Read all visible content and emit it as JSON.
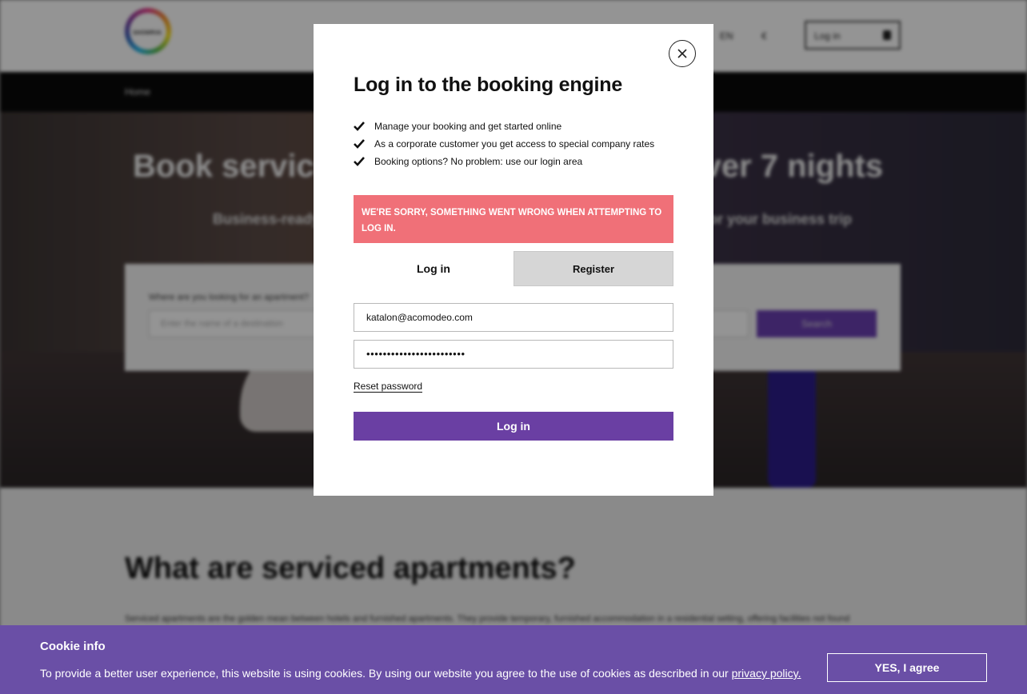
{
  "background": {
    "logo_text": "SHOWRVA",
    "language": "EN",
    "currency": "€",
    "header_login": "Log in",
    "breadcrumb": "Home",
    "hero_title": "Book serviced apartments for stays over 7 nights",
    "hero_subtitle": "Business-ready apartments",
    "hero_subtitle_2": "for your business trip",
    "search_label": "Where are you looking for an apartment?",
    "search_placeholder": "Enter the name of a destination",
    "search_button": "Search",
    "lower_title": "What are serviced apartments?",
    "lower_text": "Serviced apartments are the golden mean between hotels and furnished apartments. They provide temporary, furnished accommodation in a residential setting, offering facilities not found"
  },
  "modal": {
    "title": "Log in to the booking engine",
    "benefits": [
      "Manage your booking and get started online",
      "As a corporate customer you get access to special company rates",
      "Booking options? No problem: use our login area"
    ],
    "error": "WE'RE SORRY, SOMETHING WENT WRONG WHEN ATTEMPTING TO LOG IN.",
    "tab_login": "Log in",
    "tab_register": "Register",
    "email_value": "katalon@acomodeo.com",
    "password_value": "••••••••••••••••••••••••",
    "reset_password": "Reset password",
    "submit": "Log in"
  },
  "cookie": {
    "title": "Cookie info",
    "text": "To provide a better user experience, this website is using cookies. By using our website you agree to the use of cookies as described in our ",
    "link": "privacy policy.",
    "button": "YES, I agree"
  },
  "colors": {
    "accent": "#6a3fa3",
    "error": "#f07078",
    "cookie_bar": "#6a4fa6"
  }
}
